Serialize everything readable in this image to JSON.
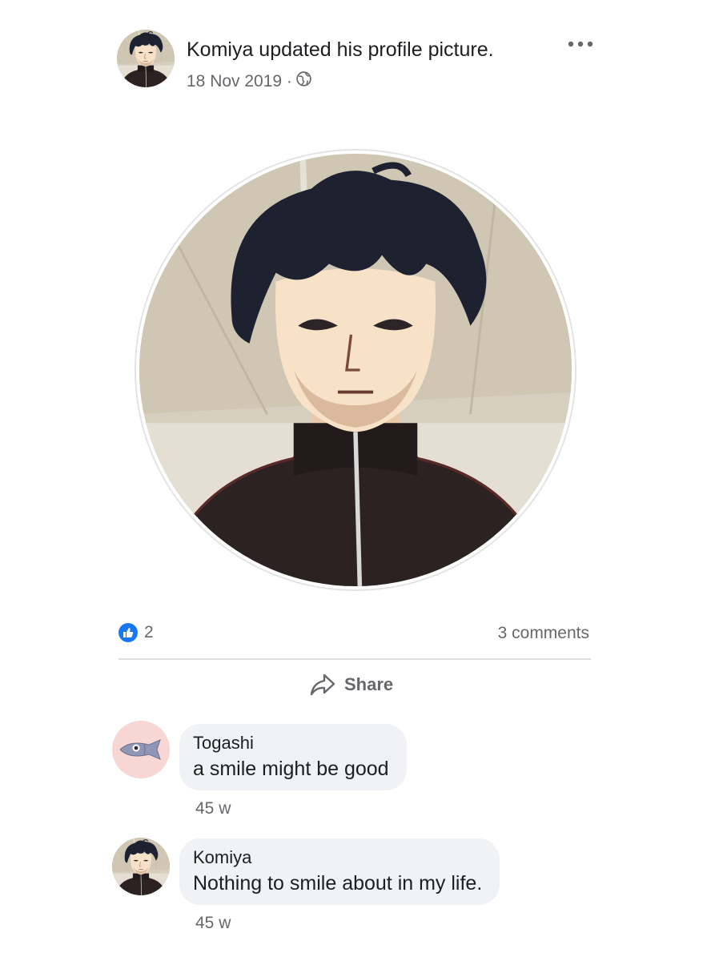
{
  "post": {
    "author": "Komiya",
    "title": "Komiya updated his profile picture.",
    "date": "18 Nov 2019 ·",
    "privacy_icon": "globe-icon",
    "more_icon": "more-options-icon"
  },
  "reactions": {
    "like_count": "2",
    "comments_label": "3 comments"
  },
  "actions": {
    "share_label": "Share"
  },
  "comments": [
    {
      "name": "Togashi",
      "text": "a smile might be good",
      "time": "45 w",
      "avatar_icon": "fish-icon"
    },
    {
      "name": "Komiya",
      "text": "Nothing to smile about in my life.",
      "time": "45 w",
      "avatar_icon": "komiya-avatar"
    }
  ],
  "colors": {
    "accent": "#1877f2",
    "muted_text": "#65676b",
    "bubble": "#f0f2f5",
    "togashi_avatar_bg": "#f7d6d4"
  }
}
